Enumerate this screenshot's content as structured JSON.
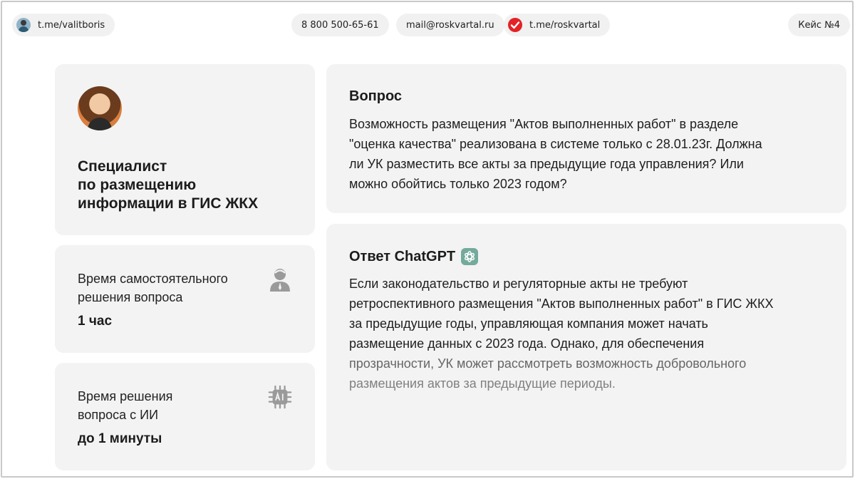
{
  "topbar": {
    "author_link": "t.me/valitboris",
    "phone": "8 800 500-65-61",
    "email": "mail@roskvartal.ru",
    "channel_link": "t.me/roskvartal",
    "case_label": "Кейс №4"
  },
  "profile": {
    "role_line1": "Специалист",
    "role_line2": "по размещению",
    "role_line3": "информации в ГИС ЖКХ"
  },
  "manual_time": {
    "label_line1": "Время самостоятельного",
    "label_line2": "решения вопроса",
    "value": "1 час",
    "icon": "person-icon"
  },
  "ai_time": {
    "label_line1": "Время решения",
    "label_line2": "вопроса с ИИ",
    "value": "до 1 минуты",
    "icon": "ai-chip-icon"
  },
  "question": {
    "heading": "Вопрос",
    "line1": "Возможность размещения \"Актов выполненных работ\" в разделе",
    "line2": "\"оценка качества\" реализована в системе только с 28.01.23г. Должна",
    "line3": "ли УК разместить все акты за предыдущие года управления? Или",
    "line4": "можно обойтись только 2023 годом?"
  },
  "answer": {
    "heading": "Ответ ChatGPT",
    "icon": "chatgpt-icon",
    "line1": "Если законодательство и регуляторные акты не требуют",
    "line2": "ретроспективного размещения \"Актов выполненных работ\" в ГИС ЖКХ",
    "line3": "за предыдущие годы, управляющая компания может начать",
    "line4": "размещение данных с 2023 года. Однако, для обеспечения",
    "line5": "прозрачности, УК может рассмотреть возможность добровольного",
    "line6": "размещения актов за предыдущие периоды."
  },
  "colors": {
    "card_bg": "#f3f3f3",
    "pill_bg": "#f1f1f1",
    "telegram_check": "#e32127",
    "chatgpt_green": "#74aa9c",
    "faded_text": "#7a7a7a"
  }
}
